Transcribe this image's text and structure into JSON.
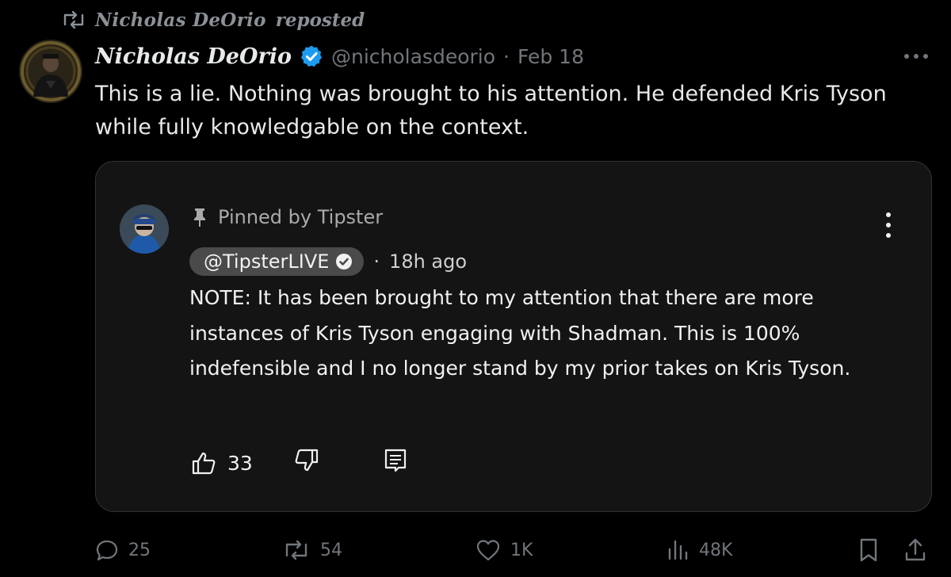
{
  "repost": {
    "name": "Nicholas DeOrio",
    "label": "reposted"
  },
  "post": {
    "author_name": "Nicholas DeOrio",
    "handle": "@nicholasdeorio",
    "separator": "·",
    "date": "Feb 18",
    "text": "This is a lie. Nothing was brought to his attention. He defended Kris Tyson while fully knowledgable on the context."
  },
  "quote": {
    "pinned_label": "Pinned by Tipster",
    "handle": "@TipsterLIVE",
    "separator": "·",
    "time": "18h ago",
    "text": "NOTE: It has been brought to my attention that there are more instances of Kris Tyson engaging with Shadman. This is 100% indefensible and I no longer stand by my prior takes on Kris Tyson.",
    "like_count": "33"
  },
  "stats": {
    "replies": "25",
    "reposts": "54",
    "likes": "1K",
    "views": "48K"
  },
  "colors": {
    "background": "#000000",
    "text": "#e7e9ea",
    "muted": "#71767b",
    "verified": "#1d9bf0",
    "card_background": "#141414",
    "card_border": "#2f3336",
    "chip": "#4a4a4a"
  }
}
